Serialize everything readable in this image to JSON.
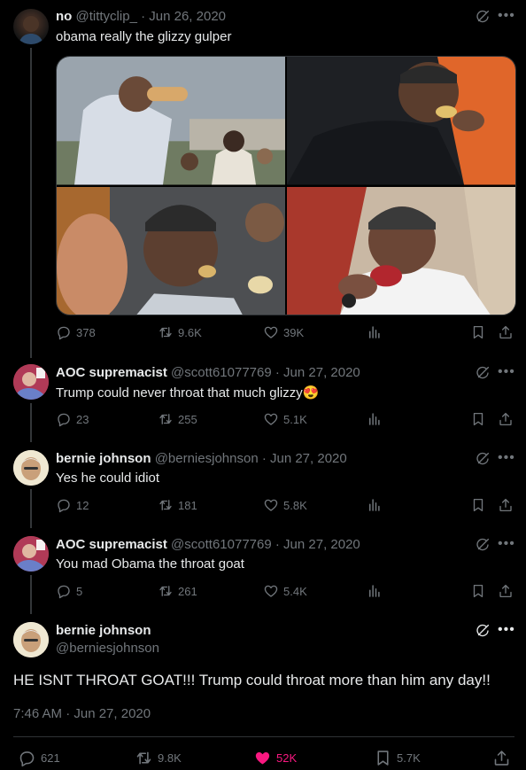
{
  "tweets": [
    {
      "name": "no",
      "handle": "@tittyclip_",
      "date": "· Jun 26, 2020",
      "text": "obama really the glizzy gulper",
      "replies": "378",
      "retweets": "9.6K",
      "likes": "39K"
    },
    {
      "name": "AOC supremacist",
      "handle": "@scott61077769",
      "date": "· Jun 27, 2020",
      "text": "Trump could never throat that much glizzy",
      "emoji": "😍",
      "replies": "23",
      "retweets": "255",
      "likes": "5.1K"
    },
    {
      "name": "bernie johnson",
      "handle": "@berniesjohnson",
      "date": "· Jun 27, 2020",
      "text": "Yes he could idiot",
      "replies": "12",
      "retweets": "181",
      "likes": "5.8K"
    },
    {
      "name": "AOC supremacist",
      "handle": "@scott61077769",
      "date": "· Jun 27, 2020",
      "text": "You mad Obama the throat goat",
      "replies": "5",
      "retweets": "261",
      "likes": "5.4K"
    }
  ],
  "focus": {
    "name": "bernie johnson",
    "handle": "@berniesjohnson",
    "text": "HE ISNT THROAT GOAT!!! Trump could throat more than him any day!!",
    "time": "7:46 AM · Jun 27, 2020",
    "replies": "621",
    "retweets": "9.8K",
    "likes": "52K",
    "bookmarks": "5.7K"
  },
  "icons": {
    "reply": "reply-icon",
    "retweet": "retweet-icon",
    "like": "heart-icon",
    "views": "analytics-icon",
    "bookmark": "bookmark-icon",
    "share": "share-icon",
    "grok": "grok-icon",
    "more": "more-icon"
  },
  "colors": {
    "background": "#000000",
    "text": "#e7e9ea",
    "muted": "#71767b",
    "like_active": "#f91880",
    "divider": "#2f3336"
  }
}
